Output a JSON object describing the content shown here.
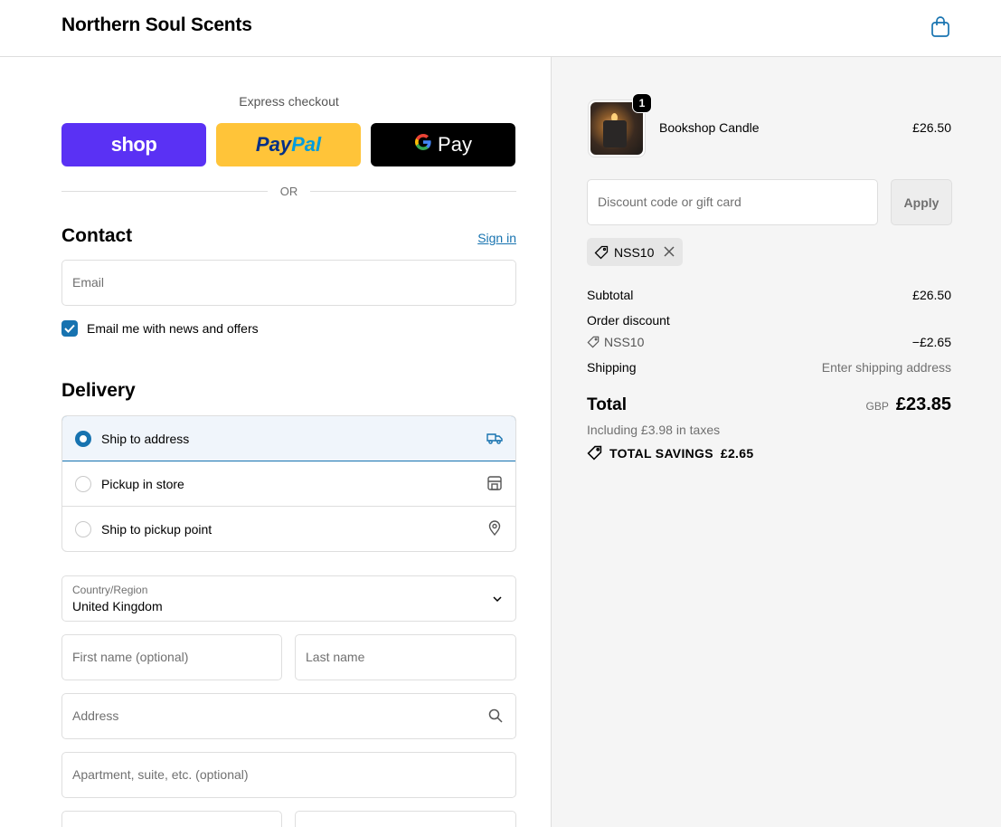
{
  "header": {
    "brand": "Northern Soul Scents",
    "cart_icon": "shopping-bag-icon"
  },
  "express": {
    "title": "Express checkout",
    "shop_label": "shop",
    "paypal_label_1": "Pay",
    "paypal_label_2": "Pal",
    "gpay_g": "G",
    "gpay_label": "Pay",
    "or": "OR"
  },
  "contact": {
    "title": "Contact",
    "sign_in": "Sign in",
    "email_placeholder": "Email",
    "newsletter_label": "Email me with news and offers",
    "newsletter_checked": true
  },
  "delivery": {
    "title": "Delivery",
    "options": [
      {
        "label": "Ship to address",
        "icon": "truck-icon",
        "selected": true
      },
      {
        "label": "Pickup in store",
        "icon": "store-icon",
        "selected": false
      },
      {
        "label": "Ship to pickup point",
        "icon": "map-pin-icon",
        "selected": false
      }
    ],
    "country_label": "Country/Region",
    "country_value": "United Kingdom",
    "first_name_placeholder": "First name (optional)",
    "last_name_placeholder": "Last name",
    "address_placeholder": "Address",
    "apartment_placeholder": "Apartment, suite, etc. (optional)"
  },
  "summary": {
    "product": {
      "name": "Bookshop Candle",
      "price": "£26.50",
      "quantity": "1"
    },
    "discount_placeholder": "Discount code or gift card",
    "apply_label": "Apply",
    "applied_code": "NSS10",
    "subtotal_label": "Subtotal",
    "subtotal_value": "£26.50",
    "order_discount_label": "Order discount",
    "discount_code": "NSS10",
    "discount_value": "−£2.65",
    "shipping_label": "Shipping",
    "shipping_value": "Enter shipping address",
    "total_label": "Total",
    "currency": "GBP",
    "total_value": "£23.85",
    "taxes_text": "Including £3.98 in taxes",
    "savings_label": "TOTAL SAVINGS",
    "savings_value": "£2.65"
  },
  "colors": {
    "accent": "#1773b0",
    "shop": "#5a31f4",
    "paypal": "#ffc439",
    "gpay": "#000000",
    "summary_bg": "#f5f5f5"
  }
}
